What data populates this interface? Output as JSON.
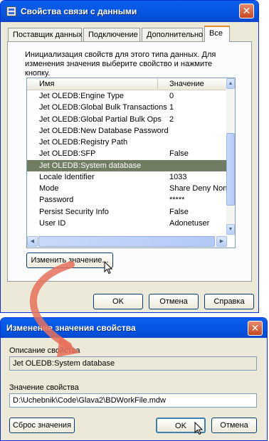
{
  "dialog1": {
    "title": "Свойства связи с данными",
    "close_glyph": "✕",
    "tabs": [
      "Поставщик данных",
      "Подключение",
      "Дополнительно",
      "Все"
    ],
    "instructions": "Инициализация свойств для этого типа данных. Для изменения значения выберите свойство и нажмите кнопку.",
    "grid": {
      "columns": [
        "Имя",
        "Значение"
      ],
      "rows": [
        {
          "name": "Jet OLEDB:Engine Type",
          "value": "0"
        },
        {
          "name": "Jet OLEDB:Global Bulk Transactions",
          "value": "1"
        },
        {
          "name": "Jet OLEDB:Global Partial Bulk Ops",
          "value": "2"
        },
        {
          "name": "Jet OLEDB:New Database Password",
          "value": ""
        },
        {
          "name": "Jet OLEDB:Registry Path",
          "value": ""
        },
        {
          "name": "Jet OLEDB:SFP",
          "value": "False"
        },
        {
          "name": "Jet OLEDB:System database",
          "value": "",
          "selected": true
        },
        {
          "name": "Locale Identifier",
          "value": "1033"
        },
        {
          "name": "Mode",
          "value": "Share Deny None"
        },
        {
          "name": "Password",
          "value": "*****"
        },
        {
          "name": "Persist Security Info",
          "value": "False"
        },
        {
          "name": "User ID",
          "value": "Adonetuser"
        }
      ]
    },
    "edit_button": "Изменить значение...",
    "ok": "OK",
    "cancel": "Отмена",
    "help": "Справка"
  },
  "dialog2": {
    "title": "Изменение значения свойства",
    "close_glyph": "✕",
    "description_label": "Описание свойства",
    "description_value": "Jet OLEDB:System database",
    "value_label": "Значение свойства",
    "value": "D:\\Uchebnik\\Code\\Glava2\\BDWorkFile.mdw",
    "reset_button": "Сброс значения",
    "ok": "OK",
    "cancel": "Отмена"
  },
  "colors": {
    "titlebar": "#0658e6",
    "selection": "#6f7d63",
    "arrow": "#e8705a"
  }
}
